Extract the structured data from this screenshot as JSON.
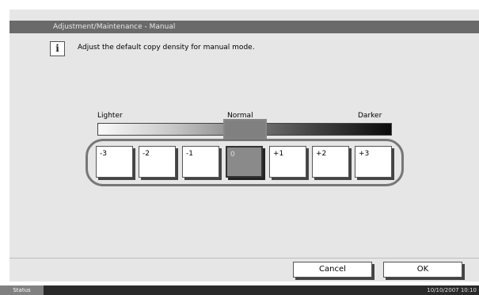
{
  "window": {
    "title": "Adjustment/Maintenance - Manual"
  },
  "info": {
    "icon": "info-icon",
    "glyph": "i",
    "message": "Adjust the default copy density for manual mode."
  },
  "scale": {
    "lighter_label": "Lighter",
    "normal_label": "Normal",
    "darker_label": "Darker"
  },
  "levels": [
    {
      "label": "-3",
      "selected": false
    },
    {
      "label": "-2",
      "selected": false
    },
    {
      "label": "-1",
      "selected": false
    },
    {
      "label": "0",
      "selected": true
    },
    {
      "label": "+1",
      "selected": false
    },
    {
      "label": "+2",
      "selected": false
    },
    {
      "label": "+3",
      "selected": false
    }
  ],
  "actions": {
    "cancel_label": "Cancel",
    "ok_label": "OK"
  },
  "status": {
    "tab_label": "Status",
    "datetime": "10/10/2007   10:10"
  },
  "colors": {
    "title_bar": "#6a6a6a",
    "panel": "#e6e6e6",
    "selected_level": "#8a8a8a",
    "status_bar": "#2a2a2a"
  }
}
